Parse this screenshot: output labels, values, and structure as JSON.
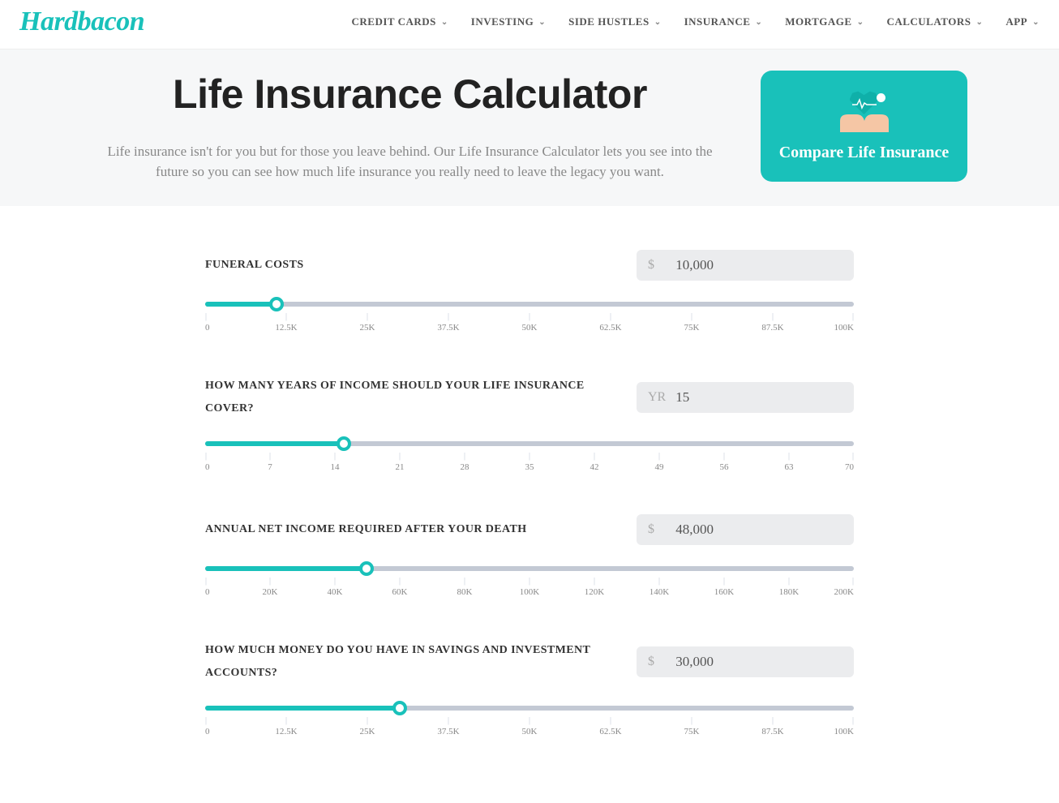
{
  "brand": "Hardbacon",
  "nav": [
    "CREDIT CARDS",
    "INVESTING",
    "SIDE HUSTLES",
    "INSURANCE",
    "MORTGAGE",
    "CALCULATORS",
    "APP"
  ],
  "hero": {
    "title": "Life Insurance Calculator",
    "desc": "Life insurance isn't for you but for those you leave behind. Our Life Insurance Calculator lets you see into the future so you can see how much life insurance you really need to leave the legacy you want."
  },
  "cta": {
    "label": "Compare Life Insurance"
  },
  "sliders": [
    {
      "label": "FUNERAL COSTS",
      "unit": "$",
      "value": "10,000",
      "fill_pct": 11,
      "ticks": [
        "0",
        "12.5K",
        "25K",
        "37.5K",
        "50K",
        "62.5K",
        "75K",
        "87.5K",
        "100K"
      ]
    },
    {
      "label": "HOW MANY YEARS OF INCOME SHOULD YOUR LIFE INSURANCE COVER?",
      "unit": "YR",
      "value": "15",
      "fill_pct": 21.4,
      "ticks": [
        "0",
        "7",
        "14",
        "21",
        "28",
        "35",
        "42",
        "49",
        "56",
        "63",
        "70"
      ]
    },
    {
      "label": "ANNUAL NET INCOME REQUIRED AFTER YOUR DEATH",
      "unit": "$",
      "value": "48,000",
      "fill_pct": 24.9,
      "ticks": [
        "0",
        "20K",
        "40K",
        "60K",
        "80K",
        "100K",
        "120K",
        "140K",
        "160K",
        "180K",
        "200K"
      ]
    },
    {
      "label": "HOW MUCH MONEY DO YOU HAVE IN SAVINGS AND INVESTMENT ACCOUNTS?",
      "unit": "$",
      "value": "30,000",
      "fill_pct": 30,
      "ticks": [
        "0",
        "12.5K",
        "25K",
        "37.5K",
        "50K",
        "62.5K",
        "75K",
        "87.5K",
        "100K"
      ]
    }
  ]
}
